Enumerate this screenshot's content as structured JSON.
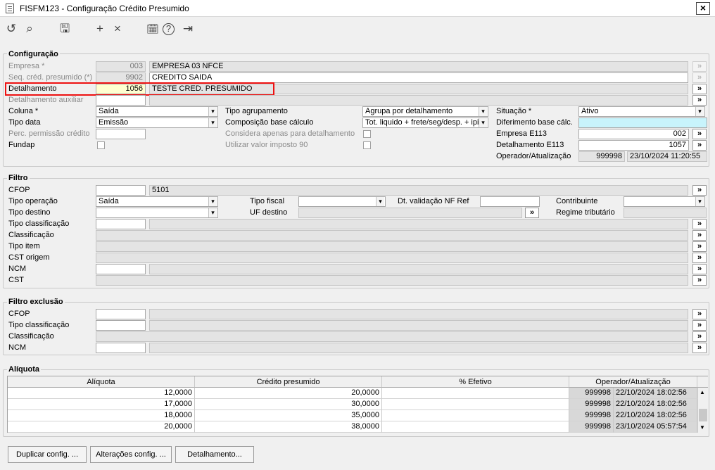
{
  "window": {
    "title": "FISFM123 - Configuração Crédito Presumido",
    "close": "✕"
  },
  "toolbar": [
    {
      "name": "refresh-icon",
      "glyph": "↺"
    },
    {
      "name": "search-icon",
      "glyph": "⌕"
    },
    {
      "name": "save-icon",
      "glyph": "🖫"
    },
    {
      "name": "add-icon",
      "glyph": "+"
    },
    {
      "name": "delete-icon",
      "glyph": "×"
    },
    {
      "name": "calendar-icon",
      "glyph": "🗓"
    },
    {
      "name": "help-icon",
      "glyph": "?"
    },
    {
      "name": "exit-icon",
      "glyph": "⇥"
    }
  ],
  "config": {
    "title": "Configuração",
    "empresa": {
      "label": "Empresa *",
      "code": "003",
      "name": "EMPRESA 03 NFCE"
    },
    "seq": {
      "label": "Seq. créd. presumido (*)",
      "code": "9902",
      "name": "CREDITO SAIDA"
    },
    "detalhamento": {
      "label": "Detalhamento",
      "code": "1056",
      "name": "TESTE CRED. PRESUMIDO"
    },
    "detalhamento_aux": {
      "label": "Detalhamento auxiliar",
      "code": "",
      "name": ""
    },
    "coluna": {
      "label": "Coluna *",
      "value": "Saída"
    },
    "tipo_data": {
      "label": "Tipo data",
      "value": "Emissão"
    },
    "perc": {
      "label": "Perc. permissão crédito",
      "value": ""
    },
    "fundap": {
      "label": "Fundap"
    },
    "tipo_agrupamento": {
      "label": "Tipo agrupamento",
      "value": "Agrupa por detalhamento"
    },
    "composicao": {
      "label": "Composição base cálculo",
      "value": "Tot. liquido + frete/seg/desp. + ipi"
    },
    "considera": {
      "label": "Considera apenas para detalhamento"
    },
    "utilizar": {
      "label": "Utilizar valor imposto 90"
    },
    "situacao": {
      "label": "Situação *",
      "value": "Ativo"
    },
    "diferimento": {
      "label": "Diferimento base cálc.",
      "value": ""
    },
    "empresa_e113": {
      "label": "Empresa E113",
      "value": "002"
    },
    "detalhamento_e113": {
      "label": "Detalhamento E113",
      "value": "1057"
    },
    "operador": {
      "label": "Operador/Atualização",
      "code": "999998",
      "date": "23/10/2024 11:20:55"
    }
  },
  "filtro": {
    "title": "Filtro",
    "cfop": {
      "label": "CFOP",
      "code": "",
      "desc": "5101"
    },
    "tipo_operacao": {
      "label": "Tipo operação",
      "value": "Saída"
    },
    "tipo_destino": {
      "label": "Tipo destino",
      "value": ""
    },
    "tipo_classificacao": {
      "label": "Tipo classificação"
    },
    "classificacao": {
      "label": "Classificação"
    },
    "tipo_item": {
      "label": "Tipo item"
    },
    "cst_origem": {
      "label": "CST origem"
    },
    "ncm": {
      "label": "NCM"
    },
    "cst": {
      "label": "CST"
    },
    "tipo_fiscal": {
      "label": "Tipo fiscal",
      "value": ""
    },
    "uf_destino": {
      "label": "UF destino",
      "value": ""
    },
    "dt_validacao": {
      "label": "Dt. validação NF Ref",
      "value": ""
    },
    "contribuinte": {
      "label": "Contribuinte",
      "value": ""
    },
    "regime": {
      "label": "Regime tributário",
      "value": ""
    }
  },
  "exclusao": {
    "title": "Filtro exclusão",
    "cfop": {
      "label": "CFOP"
    },
    "tipo_classificacao": {
      "label": "Tipo classificação"
    },
    "classificacao": {
      "label": "Classificação"
    },
    "ncm": {
      "label": "NCM"
    }
  },
  "aliquota": {
    "title": "Alíquota",
    "columns": [
      "Alíquota",
      "Crédito presumido",
      "% Efetivo",
      "Operador/Atualização"
    ],
    "rows": [
      {
        "aliquota": "12,0000",
        "credito": "20,0000",
        "efetivo": "",
        "operador": "999998",
        "data": "22/10/2024 18:02:56"
      },
      {
        "aliquota": "17,0000",
        "credito": "30,0000",
        "efetivo": "",
        "operador": "999998",
        "data": "22/10/2024 18:02:56"
      },
      {
        "aliquota": "18,0000",
        "credito": "35,0000",
        "efetivo": "",
        "operador": "999998",
        "data": "22/10/2024 18:02:56"
      },
      {
        "aliquota": "20,0000",
        "credito": "38,0000",
        "efetivo": "",
        "operador": "999998",
        "data": "23/10/2024 05:57:54"
      }
    ]
  },
  "buttons": {
    "duplicar": "Duplicar config. ...",
    "alteracoes": "Alterações config. ...",
    "detalhamento": "Detalhamento..."
  },
  "lookup_glyph": "»"
}
